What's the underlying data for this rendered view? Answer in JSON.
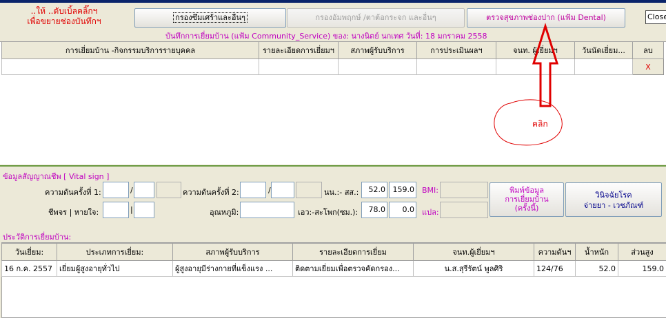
{
  "hint": {
    "line1": "..ให้ ..ดับเบิ้ลคลิ๊กฯ",
    "line2": "เพื่อขยายช่องบันทึกฯ"
  },
  "buttons": {
    "filter_other": "กรองซึมเศร้าและอื่นๆ",
    "filter_paralysis": "กรองอัมพฤกษ์ /ตาต้อกระจก และอื่นๆ",
    "dental": "ตรวจสุขภาพช่องปาก (แฟ้ม Dental)",
    "close": "Close"
  },
  "record_line": "บันทึกการเยี่ยมบ้าน (แฟ้ม Community_Service) ของ: นางนิตย์  นกเทศ วันที่: 18 มกราคม 2558",
  "activity_table": {
    "columns": [
      "การเยี่ยมบ้าน -กิจกรรมบริการรายบุคคล",
      "รายละเอียดการเยี่ยมฯ",
      "สภาพผู้รับบริการ",
      "การประเมินผลฯ",
      "จนท. ผู้เยี่ยมฯ",
      "วันนัดเยี่ยม...",
      "ลบ"
    ],
    "delete_mark": "X"
  },
  "annotation": {
    "click_label": "คลิก"
  },
  "vital": {
    "title": "ข้อมูลสัญญาณชีพ [ Vital sign ]",
    "bp1_label": "ความดันครั้งที่ 1:",
    "bp2_label": "ความดันครั้งที่ 2:",
    "slash": "/",
    "weight_height_label": "นน.:- สส.:",
    "weight": "52.0",
    "height": "159.0",
    "bmi_label": "BMI:",
    "pulse_label": "ชีพจร | หายใจ:",
    "pulse_sep": "|",
    "temp_label": "อุณหภูมิ:",
    "waist_label": "เอว:-สะโพก(ซม.):",
    "waist": "78.0",
    "hip": "0.0",
    "interpret_label": "แปล:",
    "print_button": "พิมพ์ข้อมูล การเยี่ยมบ้าน (ครั้งนี้)",
    "print_line1": "พิมพ์ข้อมูล",
    "print_line2": "การเยี่ยมบ้าน",
    "print_line3": "(ครั้งนี้)",
    "diag_line1": "วินิจฉัยโรค",
    "diag_line2": "จ่ายยา - เวชภัณฑ์"
  },
  "history": {
    "title": "ประวัติการเยี่ยมบ้าน:",
    "columns": [
      "วันเยี่ยม:",
      "ประเภทการเยี่ยม:",
      "สภาพผู้รับบริการ",
      "รายละเอียดการเยี่ยม",
      "จนท.ผู้เยี่ยมฯ",
      "ความดันฯ",
      "น้ำหนัก",
      "ส่วนสูง"
    ],
    "rows": [
      {
        "date": "16 ก.ค. 2557",
        "type": "เยี่ยมผู้สูงอายุทั่วไป",
        "condition": "ผู้สูงอายุมีร่างกายที่แข็งแรง ...",
        "detail": "ติดตามเยี่ยมเพื่อตรวจคัดกรอง...",
        "staff": "น.ส.สุรีรัตน์  พูลศิริ",
        "bp": "124/76",
        "weight": "52.0",
        "height": "159.0"
      }
    ]
  },
  "colors": {
    "accent_red": "#e00000",
    "magenta": "#c000c0",
    "navy": "#00008b"
  }
}
